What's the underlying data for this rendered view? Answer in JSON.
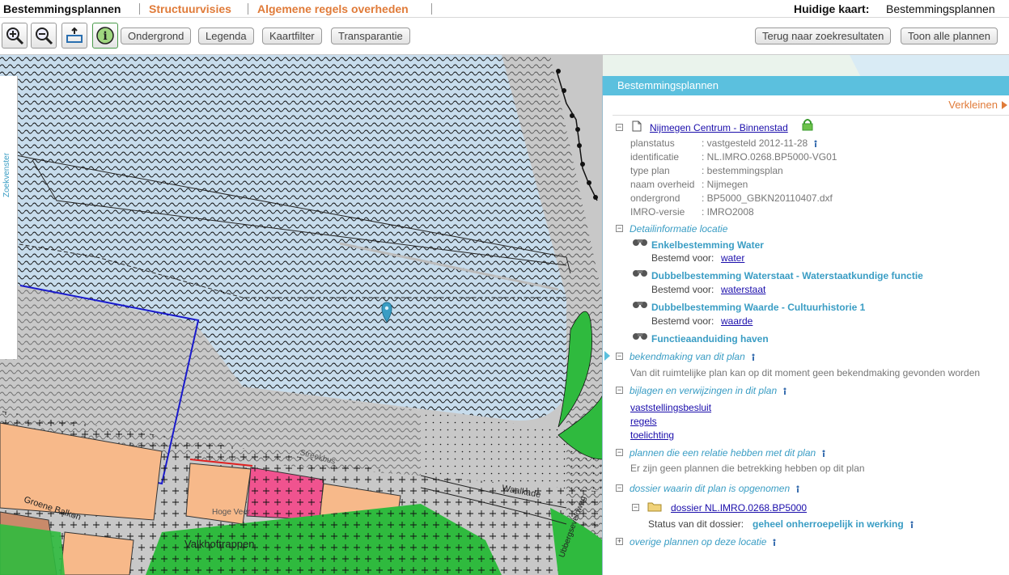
{
  "tabs": [
    {
      "label": "Bestemmingsplannen",
      "active": true
    },
    {
      "label": "Structuurvisies",
      "active": false
    },
    {
      "label": "Algemene regels overheden",
      "active": false
    }
  ],
  "current_map": {
    "label": "Huidige kaart:",
    "value": "Bestemmingsplannen"
  },
  "toolbar": {
    "tools": [
      "zoom-in-icon",
      "zoom-out-icon",
      "zoom-extent-icon",
      "info-icon"
    ],
    "buttons": [
      "Ondergrond",
      "Legenda",
      "Kaartfilter",
      "Transparantie"
    ],
    "right_buttons": [
      "Terug naar zoekresultaten",
      "Toon alle plannen"
    ]
  },
  "map": {
    "side_tab": "Zoekvenster",
    "labels": [
      "Groene Balkon",
      "Valkhoftrappen",
      "Waalkade",
      "Ubbergseveldweg",
      "Hoge Veer",
      "Streekbus"
    ],
    "colors": {
      "water": "#c7dcec",
      "grey": "#c8c8c8",
      "orange": "#f7b98a",
      "pink": "#f0538f",
      "green": "#2fba3e",
      "brown": "#c98a6a",
      "boundary": "#1a1acc"
    }
  },
  "panel": {
    "title": "Bestemmingsplannen",
    "collapse_label": "Verkleinen",
    "plan": {
      "name": "Nijmegen Centrum - Binnenstad",
      "meta": [
        {
          "key": "planstatus",
          "value": ": vastgesteld 2012-11-28"
        },
        {
          "key": "identificatie",
          "value": ": NL.IMRO.0268.BP5000-VG01"
        },
        {
          "key": "type plan",
          "value": ": bestemmingsplan"
        },
        {
          "key": "naam overheid",
          "value": ": Nijmegen"
        },
        {
          "key": "ondergrond",
          "value": ": BP5000_GBKN20110407.dxf"
        },
        {
          "key": "IMRO-versie",
          "value": ": IMRO2008"
        }
      ]
    },
    "detail": {
      "title": "Detailinformatie locatie",
      "items": [
        {
          "name": "Enkelbestemming Water",
          "prefix": "Bestemd voor:",
          "link": "water"
        },
        {
          "name": "Dubbelbestemming Waterstaat - Waterstaatkundige functie",
          "prefix": "Bestemd voor:",
          "link": "waterstaat"
        },
        {
          "name": "Dubbelbestemming Waarde - Cultuurhistorie 1",
          "prefix": "Bestemd voor:",
          "link": "waarde"
        },
        {
          "name": "Functieaanduiding haven",
          "prefix": "",
          "link": ""
        }
      ]
    },
    "bekendmaking": {
      "title": "bekendmaking van dit plan",
      "text": "Van dit ruimtelijke plan kan op dit moment geen bekendmaking gevonden worden"
    },
    "bijlagen": {
      "title": "bijlagen en verwijzingen in dit plan",
      "links": [
        "vaststellingsbesluit",
        "regels",
        "toelichting"
      ]
    },
    "relatie": {
      "title": "plannen die een relatie hebben met dit plan",
      "text": "Er zijn geen plannen die betrekking hebben op dit plan"
    },
    "dossier": {
      "title": "dossier waarin dit plan is opgenomen",
      "link": "dossier NL.IMRO.0268.BP5000",
      "status_label": "Status van dit dossier:",
      "status_value": "geheel onherroepelijk in werking"
    },
    "overige": {
      "title": "overige plannen op deze locatie"
    }
  }
}
